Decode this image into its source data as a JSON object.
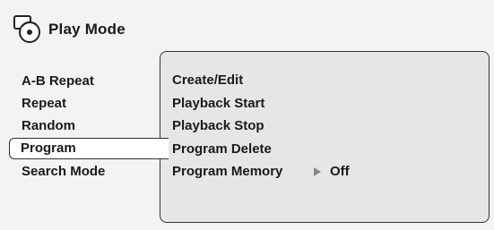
{
  "header": {
    "title": "Play Mode",
    "icon": "disc-settings-icon"
  },
  "menu": {
    "items": [
      {
        "label": "A-B Repeat"
      },
      {
        "label": "Repeat"
      },
      {
        "label": "Random"
      },
      {
        "label": "Program",
        "selected": true
      },
      {
        "label": "Search Mode"
      }
    ]
  },
  "submenu": {
    "items": [
      {
        "label": "Create/Edit"
      },
      {
        "label": "Playback Start"
      },
      {
        "label": "Playback Stop"
      },
      {
        "label": "Program Delete"
      },
      {
        "label": "Program Memory",
        "value": "Off"
      }
    ]
  },
  "colors": {
    "background": "#f3f3f3",
    "panel": "#e6e6e6",
    "border": "#333333",
    "selected": "#ffffff"
  }
}
